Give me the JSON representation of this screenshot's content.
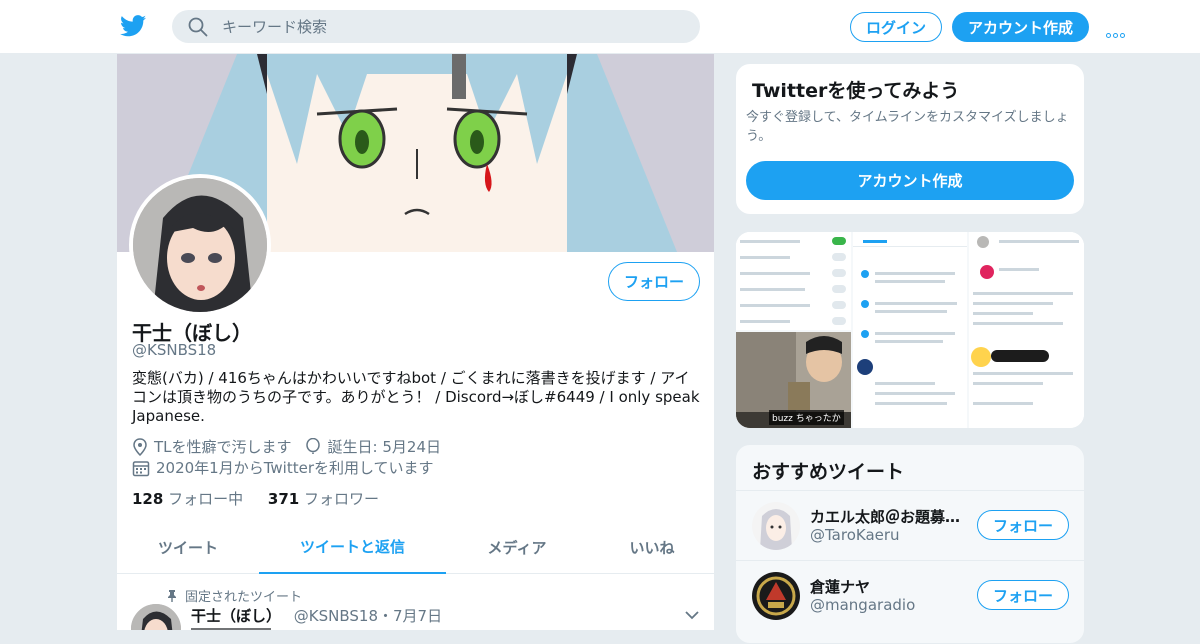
{
  "colors": {
    "accent": "#1da1f2",
    "muted": "#657786",
    "text": "#14171a",
    "bg": "#e6ecf0"
  },
  "header": {
    "search_placeholder": "キーワード検索",
    "login": "ログイン",
    "signup": "アカウント作成"
  },
  "profile": {
    "name": "干士（ぼし）",
    "handle": "@KSNBS18",
    "follow": "フォロー",
    "bio": "変態(バカ) / 416ちゃんはかわいいですねbot / ごくまれに落書きを投げます / アイコンは頂き物のうちの子です。ありがとう！ / Discord→ぼし#6449 / I only speak Japanese.",
    "location": "TLを性癖で汚します",
    "birthday": "誕生日: 5月24日",
    "joined": "2020年1月からTwitterを利用しています",
    "following_count": "128",
    "following_label": "フォロー中",
    "followers_count": "371",
    "followers_label": "フォロワー"
  },
  "tabs": [
    "ツイート",
    "ツイートと返信",
    "メディア",
    "いいね"
  ],
  "pinned": {
    "label": "固定されたツイート",
    "name": "干士（ぼし）",
    "handle_date": "@KSNBS18・7月7日"
  },
  "signup_card": {
    "title": "Twitterを使ってみよう",
    "text": "今すぐ登録して、タイムラインをカスタマイズしましょう。",
    "button": "アカウント作成"
  },
  "media": {
    "caption": "buzz ちゃったか"
  },
  "recommended": {
    "title": "おすすめツイート",
    "users": [
      {
        "name": "カエル太郎＠お題募集中",
        "handle": "@TaroKaeru",
        "button": "フォロー"
      },
      {
        "name": "倉蓮ナヤ",
        "handle": "@mangaradio",
        "button": "フォロー"
      }
    ]
  }
}
